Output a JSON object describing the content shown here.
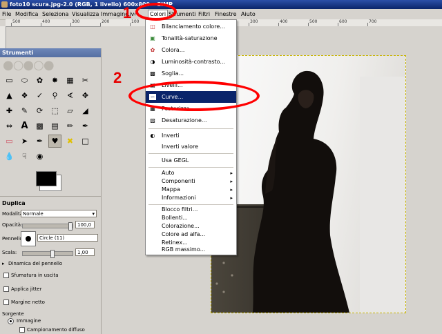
{
  "window": {
    "title": "foto10 scura.jpg-2.0 (RGB, 1 livello) 600x800 – GIMP"
  },
  "menubar": {
    "items": [
      {
        "label": "File"
      },
      {
        "label": "Modifica"
      },
      {
        "label": "Seleziona"
      },
      {
        "label": "Visualizza"
      },
      {
        "label": "Immagine"
      },
      {
        "label": "Livello"
      },
      {
        "label": "Colori"
      },
      {
        "label": "Strumenti"
      },
      {
        "label": "Filtri"
      },
      {
        "label": "Finestre"
      },
      {
        "label": "Aiuto"
      }
    ]
  },
  "ruler": {
    "labels": [
      "500",
      "400",
      "300",
      "200",
      "100",
      "0",
      "100",
      "200",
      "300",
      "400",
      "500",
      "600",
      "700"
    ]
  },
  "colors_menu": {
    "items": [
      {
        "label": "Bilanciamento colore...",
        "icon": "color-balance-icon"
      },
      {
        "label": "Tonalità-saturazione",
        "icon": "hue-saturation-icon"
      },
      {
        "label": "Colora...",
        "icon": "colorize-icon"
      },
      {
        "label": "Luminosità-contrasto...",
        "icon": "brightness-contrast-icon"
      },
      {
        "label": "Soglia...",
        "icon": "threshold-icon"
      },
      {
        "label": "Livelli...",
        "icon": "levels-icon"
      },
      {
        "label": "Curve...",
        "icon": "curves-icon"
      },
      {
        "label": "Posterizza...",
        "icon": "posterize-icon"
      },
      {
        "label": "Desaturazione...",
        "icon": "desaturate-icon"
      },
      {
        "label": "Inverti",
        "icon": "invert-icon"
      },
      {
        "label": "Inverti valore",
        "icon": ""
      },
      {
        "label": "Usa GEGL",
        "icon": ""
      },
      {
        "label": "Auto",
        "submenu": true
      },
      {
        "label": "Componenti",
        "submenu": true
      },
      {
        "label": "Mappa",
        "submenu": true
      },
      {
        "label": "Informazioni",
        "submenu": true
      },
      {
        "label": "Blocco filtri..."
      },
      {
        "label": "Bollenti..."
      },
      {
        "label": "Colorazione..."
      },
      {
        "label": "Colore ad alfa..."
      },
      {
        "label": "Retinex..."
      },
      {
        "label": "RGB massimo..."
      }
    ],
    "highlight_color": "#0a246a"
  },
  "toolbox": {
    "title": "Strumenti",
    "tools": [
      "rect-select-icon",
      "ellipse-select-icon",
      "free-select-icon",
      "fuzzy-select-icon",
      "select-by-color-icon",
      "scissors-icon",
      "foreground-select-icon",
      "paths-icon",
      "color-picker-icon",
      "zoom-icon",
      "measure-icon",
      "move-icon",
      "align-icon",
      "crop-icon",
      "rotate-icon",
      "scale-icon",
      "shear-icon",
      "perspective-icon",
      "flip-icon",
      "text-icon",
      "bucket-fill-icon",
      "blend-icon",
      "pencil-icon",
      "paintbrush-icon",
      "eraser-icon",
      "airbrush-icon",
      "ink-icon",
      "clone-icon",
      "heal-icon",
      "perspective-clone-icon",
      "blur-icon",
      "smudge-icon",
      "dodge-burn-icon"
    ],
    "options": {
      "title": "Duplica",
      "mode_label": "Modalità:",
      "mode_value": "Normale",
      "opacity_label": "Opacità:",
      "opacity_value": "100,0",
      "brush_label": "Pennello:",
      "brush_value": "Circle (11)",
      "scale_label": "Scala:",
      "scale_value": "1,00",
      "dynamics_label": "Dinamica del pennello",
      "fade_label": "Sfumatura in uscita",
      "jitter_label": "Applica jitter",
      "hard_edge_label": "Margine netto",
      "source_label": "Sorgente",
      "source_image_label": "Immagine",
      "sample_merged_label": "Campionamento diffuso"
    }
  },
  "annotations": {
    "step1": "1",
    "step2": "2",
    "color": "#ff0000"
  }
}
